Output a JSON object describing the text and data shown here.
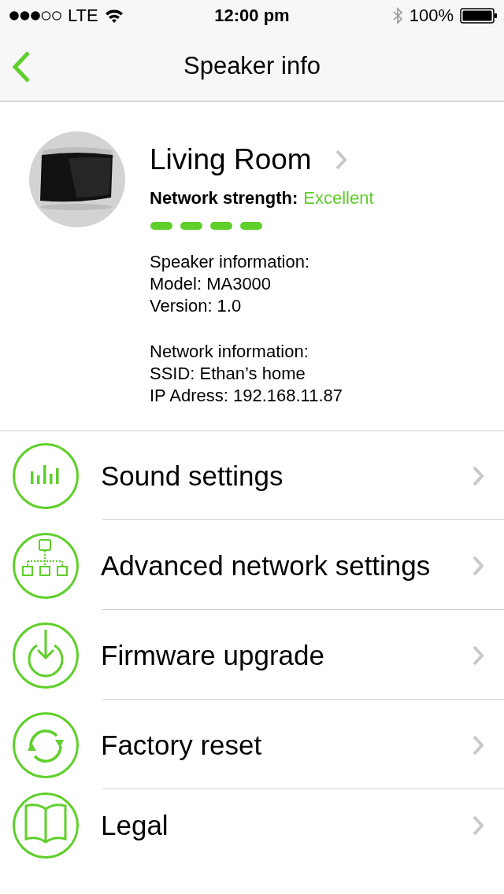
{
  "status_bar": {
    "carrier": "LTE",
    "time": "12:00 pm",
    "battery": "100%"
  },
  "nav": {
    "title": "Speaker info"
  },
  "speaker": {
    "kind": "picture",
    "name": "Living Room",
    "strength_label": "Network strength:",
    "strength_value": "Excellent",
    "sections": [
      {
        "heading": "Speaker information:",
        "lines": [
          "Model: MA3000",
          "Version: 1.0"
        ]
      },
      {
        "heading": "Network information:",
        "lines": [
          "SSID: Ethan’s home",
          "IP Adress: 192.168.11.87"
        ]
      }
    ]
  },
  "menu": [
    {
      "label": "Sound settings"
    },
    {
      "label": "Advanced network settings"
    },
    {
      "label": "Firmware upgrade"
    },
    {
      "label": "Factory reset"
    },
    {
      "label": "Legal"
    }
  ]
}
